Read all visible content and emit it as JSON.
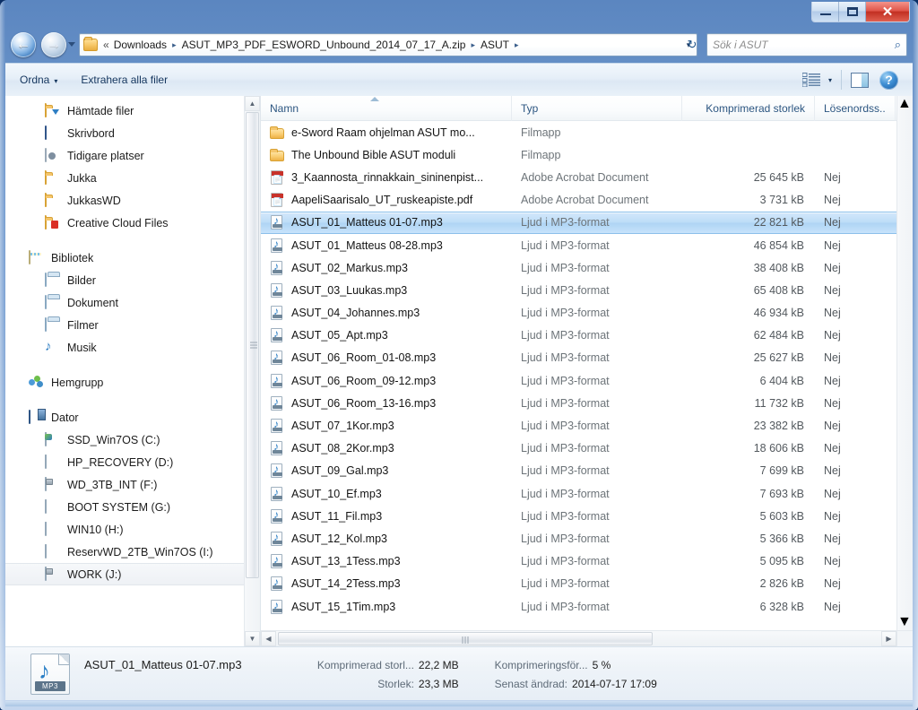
{
  "window": {
    "controls": {
      "minimize": "—",
      "maximize": "□",
      "close": "✕"
    }
  },
  "navigation": {
    "back_icon": "←",
    "forward_icon": "→",
    "history_dropdown": "",
    "refresh_icon": "↻",
    "breadcrumb": {
      "overflow": "«",
      "segments": [
        "Downloads",
        "ASUT_MP3_PDF_ESWORD_Unbound_2014_07_17_A.zip",
        "ASUT"
      ],
      "separator": "▸",
      "dropdown_icon": "▾"
    },
    "search": {
      "placeholder": "Sök i ASUT",
      "icon": "⌕"
    }
  },
  "toolbar": {
    "organize_label": "Ordna",
    "organize_caret": "▾",
    "extract_label": "Extrahera alla filer",
    "views_caret": "▾",
    "help_label": "?"
  },
  "sidebar": {
    "groups": [
      {
        "items": [
          {
            "label": "Hämtade filer",
            "icon": "folder-download-icon",
            "indent": 1
          },
          {
            "label": "Skrivbord",
            "icon": "desktop-icon",
            "indent": 1
          },
          {
            "label": "Tidigare platser",
            "icon": "recent-places-icon",
            "indent": 1
          },
          {
            "label": "Jukka",
            "icon": "folder-icon",
            "indent": 1
          },
          {
            "label": "JukkasWD",
            "icon": "folder-icon",
            "indent": 1
          },
          {
            "label": "Creative Cloud Files",
            "icon": "folder-creative-cloud-icon",
            "indent": 1
          }
        ]
      },
      {
        "items": [
          {
            "label": "Bibliotek",
            "icon": "library-icon",
            "indent": 0
          },
          {
            "label": "Bilder",
            "icon": "pictures-library-icon",
            "indent": 1
          },
          {
            "label": "Dokument",
            "icon": "documents-library-icon",
            "indent": 1
          },
          {
            "label": "Filmer",
            "icon": "videos-library-icon",
            "indent": 1
          },
          {
            "label": "Musik",
            "icon": "music-library-icon",
            "indent": 1
          }
        ]
      },
      {
        "items": [
          {
            "label": "Hemgrupp",
            "icon": "homegroup-icon",
            "indent": 0
          }
        ]
      },
      {
        "items": [
          {
            "label": "Dator",
            "icon": "computer-icon",
            "indent": 0
          },
          {
            "label": "SSD_Win7OS (C:)",
            "icon": "system-drive-icon",
            "indent": 1
          },
          {
            "label": "HP_RECOVERY (D:)",
            "icon": "drive-icon",
            "indent": 1
          },
          {
            "label": "WD_3TB_INT (F:)",
            "icon": "usb-drive-icon",
            "indent": 1
          },
          {
            "label": "BOOT SYSTEM (G:)",
            "icon": "drive-icon",
            "indent": 1
          },
          {
            "label": "WIN10 (H:)",
            "icon": "drive-icon",
            "indent": 1
          },
          {
            "label": "ReservWD_2TB_Win7OS (I:)",
            "icon": "drive-icon",
            "indent": 1
          },
          {
            "label": "WORK (J:)",
            "icon": "usb-drive-icon",
            "indent": 1,
            "selected": true
          }
        ]
      }
    ]
  },
  "filelist": {
    "columns": [
      {
        "key": "name",
        "label": "Namn",
        "sorted": true
      },
      {
        "key": "type",
        "label": "Typ"
      },
      {
        "key": "size",
        "label": "Komprimerad storlek",
        "align": "right"
      },
      {
        "key": "password",
        "label": "Lösenordss.."
      }
    ],
    "rows": [
      {
        "name": "e-Sword Raam ohjelman ASUT mo...",
        "type": "Filmapp",
        "size": "",
        "password": "",
        "icon": "folder-icon"
      },
      {
        "name": "The Unbound Bible ASUT moduli",
        "type": "Filmapp",
        "size": "",
        "password": "",
        "icon": "folder-icon"
      },
      {
        "name": "3_Kaannosta_rinnakkain_sininenpist...",
        "type": "Adobe Acrobat Document",
        "size": "25 645 kB",
        "password": "Nej",
        "icon": "pdf-icon"
      },
      {
        "name": "AapeliSaarisalo_UT_ruskeapiste.pdf",
        "type": "Adobe Acrobat Document",
        "size": "3 731 kB",
        "password": "Nej",
        "icon": "pdf-icon"
      },
      {
        "name": "ASUT_01_Matteus 01-07.mp3",
        "type": "Ljud i MP3-format",
        "size": "22 821 kB",
        "password": "Nej",
        "icon": "mp3-icon",
        "selected": true
      },
      {
        "name": "ASUT_01_Matteus 08-28.mp3",
        "type": "Ljud i MP3-format",
        "size": "46 854 kB",
        "password": "Nej",
        "icon": "mp3-icon"
      },
      {
        "name": "ASUT_02_Markus.mp3",
        "type": "Ljud i MP3-format",
        "size": "38 408 kB",
        "password": "Nej",
        "icon": "mp3-icon"
      },
      {
        "name": "ASUT_03_Luukas.mp3",
        "type": "Ljud i MP3-format",
        "size": "65 408 kB",
        "password": "Nej",
        "icon": "mp3-icon"
      },
      {
        "name": "ASUT_04_Johannes.mp3",
        "type": "Ljud i MP3-format",
        "size": "46 934 kB",
        "password": "Nej",
        "icon": "mp3-icon"
      },
      {
        "name": "ASUT_05_Apt.mp3",
        "type": "Ljud i MP3-format",
        "size": "62 484 kB",
        "password": "Nej",
        "icon": "mp3-icon"
      },
      {
        "name": "ASUT_06_Room_01-08.mp3",
        "type": "Ljud i MP3-format",
        "size": "25 627 kB",
        "password": "Nej",
        "icon": "mp3-icon"
      },
      {
        "name": "ASUT_06_Room_09-12.mp3",
        "type": "Ljud i MP3-format",
        "size": "6 404 kB",
        "password": "Nej",
        "icon": "mp3-icon"
      },
      {
        "name": "ASUT_06_Room_13-16.mp3",
        "type": "Ljud i MP3-format",
        "size": "11 732 kB",
        "password": "Nej",
        "icon": "mp3-icon"
      },
      {
        "name": "ASUT_07_1Kor.mp3",
        "type": "Ljud i MP3-format",
        "size": "23 382 kB",
        "password": "Nej",
        "icon": "mp3-icon"
      },
      {
        "name": "ASUT_08_2Kor.mp3",
        "type": "Ljud i MP3-format",
        "size": "18 606 kB",
        "password": "Nej",
        "icon": "mp3-icon"
      },
      {
        "name": "ASUT_09_Gal.mp3",
        "type": "Ljud i MP3-format",
        "size": "7 699 kB",
        "password": "Nej",
        "icon": "mp3-icon"
      },
      {
        "name": "ASUT_10_Ef.mp3",
        "type": "Ljud i MP3-format",
        "size": "7 693 kB",
        "password": "Nej",
        "icon": "mp3-icon"
      },
      {
        "name": "ASUT_11_Fil.mp3",
        "type": "Ljud i MP3-format",
        "size": "5 603 kB",
        "password": "Nej",
        "icon": "mp3-icon"
      },
      {
        "name": "ASUT_12_Kol.mp3",
        "type": "Ljud i MP3-format",
        "size": "5 366 kB",
        "password": "Nej",
        "icon": "mp3-icon"
      },
      {
        "name": "ASUT_13_1Tess.mp3",
        "type": "Ljud i MP3-format",
        "size": "5 095 kB",
        "password": "Nej",
        "icon": "mp3-icon"
      },
      {
        "name": "ASUT_14_2Tess.mp3",
        "type": "Ljud i MP3-format",
        "size": "2 826 kB",
        "password": "Nej",
        "icon": "mp3-icon"
      },
      {
        "name": "ASUT_15_1Tim.mp3",
        "type": "Ljud i MP3-format",
        "size": "6 328 kB",
        "password": "Nej",
        "icon": "mp3-icon"
      }
    ]
  },
  "details": {
    "filename": "ASUT_01_Matteus 01-07.mp3",
    "compressed_size_label": "Komprimerad storl...",
    "compressed_size_value": "22,2 MB",
    "size_label": "Storlek:",
    "size_value": "23,3 MB",
    "ratio_label": "Komprimeringsför...",
    "ratio_value": "5 %",
    "modified_label": "Senast ändrad:",
    "modified_value": "2014-07-17 17:09",
    "icon_badge": "MP3"
  }
}
